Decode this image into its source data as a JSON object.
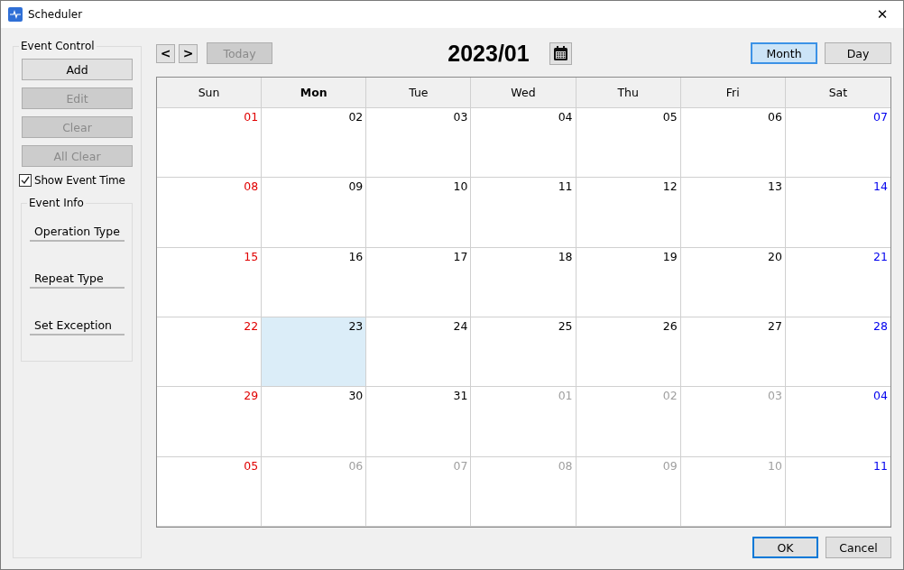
{
  "window": {
    "title": "Scheduler",
    "close": "✕"
  },
  "event_control": {
    "title": "Event Control",
    "buttons": [
      {
        "label": "Add",
        "disabled": false
      },
      {
        "label": "Edit",
        "disabled": true
      },
      {
        "label": "Clear",
        "disabled": true
      },
      {
        "label": "All Clear",
        "disabled": true
      }
    ],
    "show_event_time": {
      "label": "Show Event Time",
      "checked": true
    },
    "event_info": {
      "title": "Event Info",
      "fields": [
        "Operation Type",
        "Repeat Type",
        "Set Exception"
      ]
    }
  },
  "toolbar": {
    "prev": "<",
    "next": ">",
    "today": {
      "label": "Today",
      "disabled": true
    },
    "month_title": "2023/01",
    "views": [
      {
        "label": "Month",
        "selected": true
      },
      {
        "label": "Day",
        "selected": false
      }
    ]
  },
  "calendar": {
    "headers": [
      {
        "label": "Sun",
        "selected": false
      },
      {
        "label": "Mon",
        "selected": true
      },
      {
        "label": "Tue",
        "selected": false
      },
      {
        "label": "Wed",
        "selected": false
      },
      {
        "label": "Thu",
        "selected": false
      },
      {
        "label": "Fri",
        "selected": false
      },
      {
        "label": "Sat",
        "selected": false
      }
    ],
    "weeks": [
      [
        {
          "label": "01",
          "kind": "sun",
          "selected": false
        },
        {
          "label": "02",
          "kind": "weekday",
          "selected": false
        },
        {
          "label": "03",
          "kind": "weekday",
          "selected": false
        },
        {
          "label": "04",
          "kind": "weekday",
          "selected": false
        },
        {
          "label": "05",
          "kind": "weekday",
          "selected": false
        },
        {
          "label": "06",
          "kind": "weekday",
          "selected": false
        },
        {
          "label": "07",
          "kind": "sat",
          "selected": false
        }
      ],
      [
        {
          "label": "08",
          "kind": "sun",
          "selected": false
        },
        {
          "label": "09",
          "kind": "weekday",
          "selected": false
        },
        {
          "label": "10",
          "kind": "weekday",
          "selected": false
        },
        {
          "label": "11",
          "kind": "weekday",
          "selected": false
        },
        {
          "label": "12",
          "kind": "weekday",
          "selected": false
        },
        {
          "label": "13",
          "kind": "weekday",
          "selected": false
        },
        {
          "label": "14",
          "kind": "sat",
          "selected": false
        }
      ],
      [
        {
          "label": "15",
          "kind": "sun",
          "selected": false
        },
        {
          "label": "16",
          "kind": "weekday",
          "selected": false
        },
        {
          "label": "17",
          "kind": "weekday",
          "selected": false
        },
        {
          "label": "18",
          "kind": "weekday",
          "selected": false
        },
        {
          "label": "19",
          "kind": "weekday",
          "selected": false
        },
        {
          "label": "20",
          "kind": "weekday",
          "selected": false
        },
        {
          "label": "21",
          "kind": "sat",
          "selected": false
        }
      ],
      [
        {
          "label": "22",
          "kind": "sun",
          "selected": false
        },
        {
          "label": "23",
          "kind": "weekday",
          "selected": true
        },
        {
          "label": "24",
          "kind": "weekday",
          "selected": false
        },
        {
          "label": "25",
          "kind": "weekday",
          "selected": false
        },
        {
          "label": "26",
          "kind": "weekday",
          "selected": false
        },
        {
          "label": "27",
          "kind": "weekday",
          "selected": false
        },
        {
          "label": "28",
          "kind": "sat",
          "selected": false
        }
      ],
      [
        {
          "label": "29",
          "kind": "sun",
          "selected": false
        },
        {
          "label": "30",
          "kind": "weekday",
          "selected": false
        },
        {
          "label": "31",
          "kind": "weekday",
          "selected": false
        },
        {
          "label": "01",
          "kind": "outside",
          "selected": false
        },
        {
          "label": "02",
          "kind": "outside",
          "selected": false
        },
        {
          "label": "03",
          "kind": "outside",
          "selected": false
        },
        {
          "label": "04",
          "kind": "sat",
          "selected": false
        }
      ],
      [
        {
          "label": "05",
          "kind": "sun",
          "selected": false
        },
        {
          "label": "06",
          "kind": "outside",
          "selected": false
        },
        {
          "label": "07",
          "kind": "outside",
          "selected": false
        },
        {
          "label": "08",
          "kind": "outside",
          "selected": false
        },
        {
          "label": "09",
          "kind": "outside",
          "selected": false
        },
        {
          "label": "10",
          "kind": "outside",
          "selected": false
        },
        {
          "label": "11",
          "kind": "sat",
          "selected": false
        }
      ]
    ]
  },
  "footer": {
    "buttons": [
      {
        "label": "OK",
        "default": true
      },
      {
        "label": "Cancel",
        "default": false
      }
    ]
  }
}
